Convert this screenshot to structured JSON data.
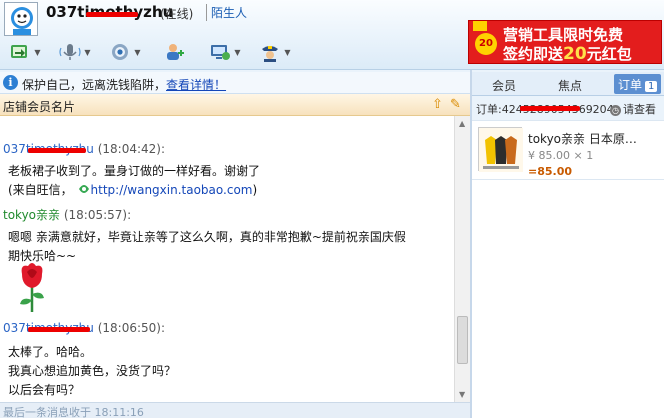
{
  "header": {
    "username": "037timothyzhu",
    "status": "(在线)",
    "stranger_label": "陌生人"
  },
  "toolbar": {
    "items": [
      {
        "icon": "transfer-file-icon",
        "has_caret": true
      },
      {
        "icon": "voice-call-icon",
        "has_caret": true
      },
      {
        "icon": "video-call-icon",
        "has_caret": true
      },
      {
        "icon": "add-contact-icon",
        "has_caret": false
      },
      {
        "icon": "remote-assist-icon",
        "has_caret": true
      },
      {
        "icon": "security-officer-icon",
        "has_caret": true
      }
    ]
  },
  "ad": {
    "line1": "营销工具限时免费",
    "line2_prefix": "签约即送",
    "line2_amount": "20",
    "line2_suffix": "元红包",
    "badge": "20"
  },
  "notice": {
    "text": "保护自己，远离洗钱陷阱，",
    "link": "查看详情！"
  },
  "card_bar": {
    "title": "店铺会员名片"
  },
  "chat": {
    "messages": [
      {
        "sender": "037timothyzhu",
        "time": "(18:04:42):",
        "lines": [
          "老板裙子收到了。量身订做的一样好看。谢谢了"
        ],
        "extra_prefix": "(来自旺信，",
        "extra_url": "http://wangxin.taobao.com",
        "extra_suffix": ")"
      },
      {
        "sender": "tokyo亲亲",
        "time": "(18:05:57):",
        "lines": [
          "嗯嗯 亲满意就好，毕竟让亲等了这么久啊，真的非常抱歉~提前祝亲国庆假",
          "期快乐哈~~"
        ]
      },
      {
        "sender": "037timothyzhu",
        "time": "(18:06:50):",
        "lines": [
          "太棒了。哈哈。",
          "我真心想追加黄色，没货了吗？",
          "以后会有吗？"
        ]
      }
    ]
  },
  "statusbar": {
    "text": "最后一条消息收于 18:11:16"
  },
  "right": {
    "tabs": [
      {
        "label": "会员"
      },
      {
        "label": "焦点"
      },
      {
        "label": "订单",
        "count": "1"
      }
    ],
    "order_label": "订单:4245289054369204",
    "check_label": "请查看",
    "order": {
      "title": "tokyo亲亲 日本原…",
      "price": "¥ 85.00 × 1",
      "total": "=85.00"
    }
  }
}
